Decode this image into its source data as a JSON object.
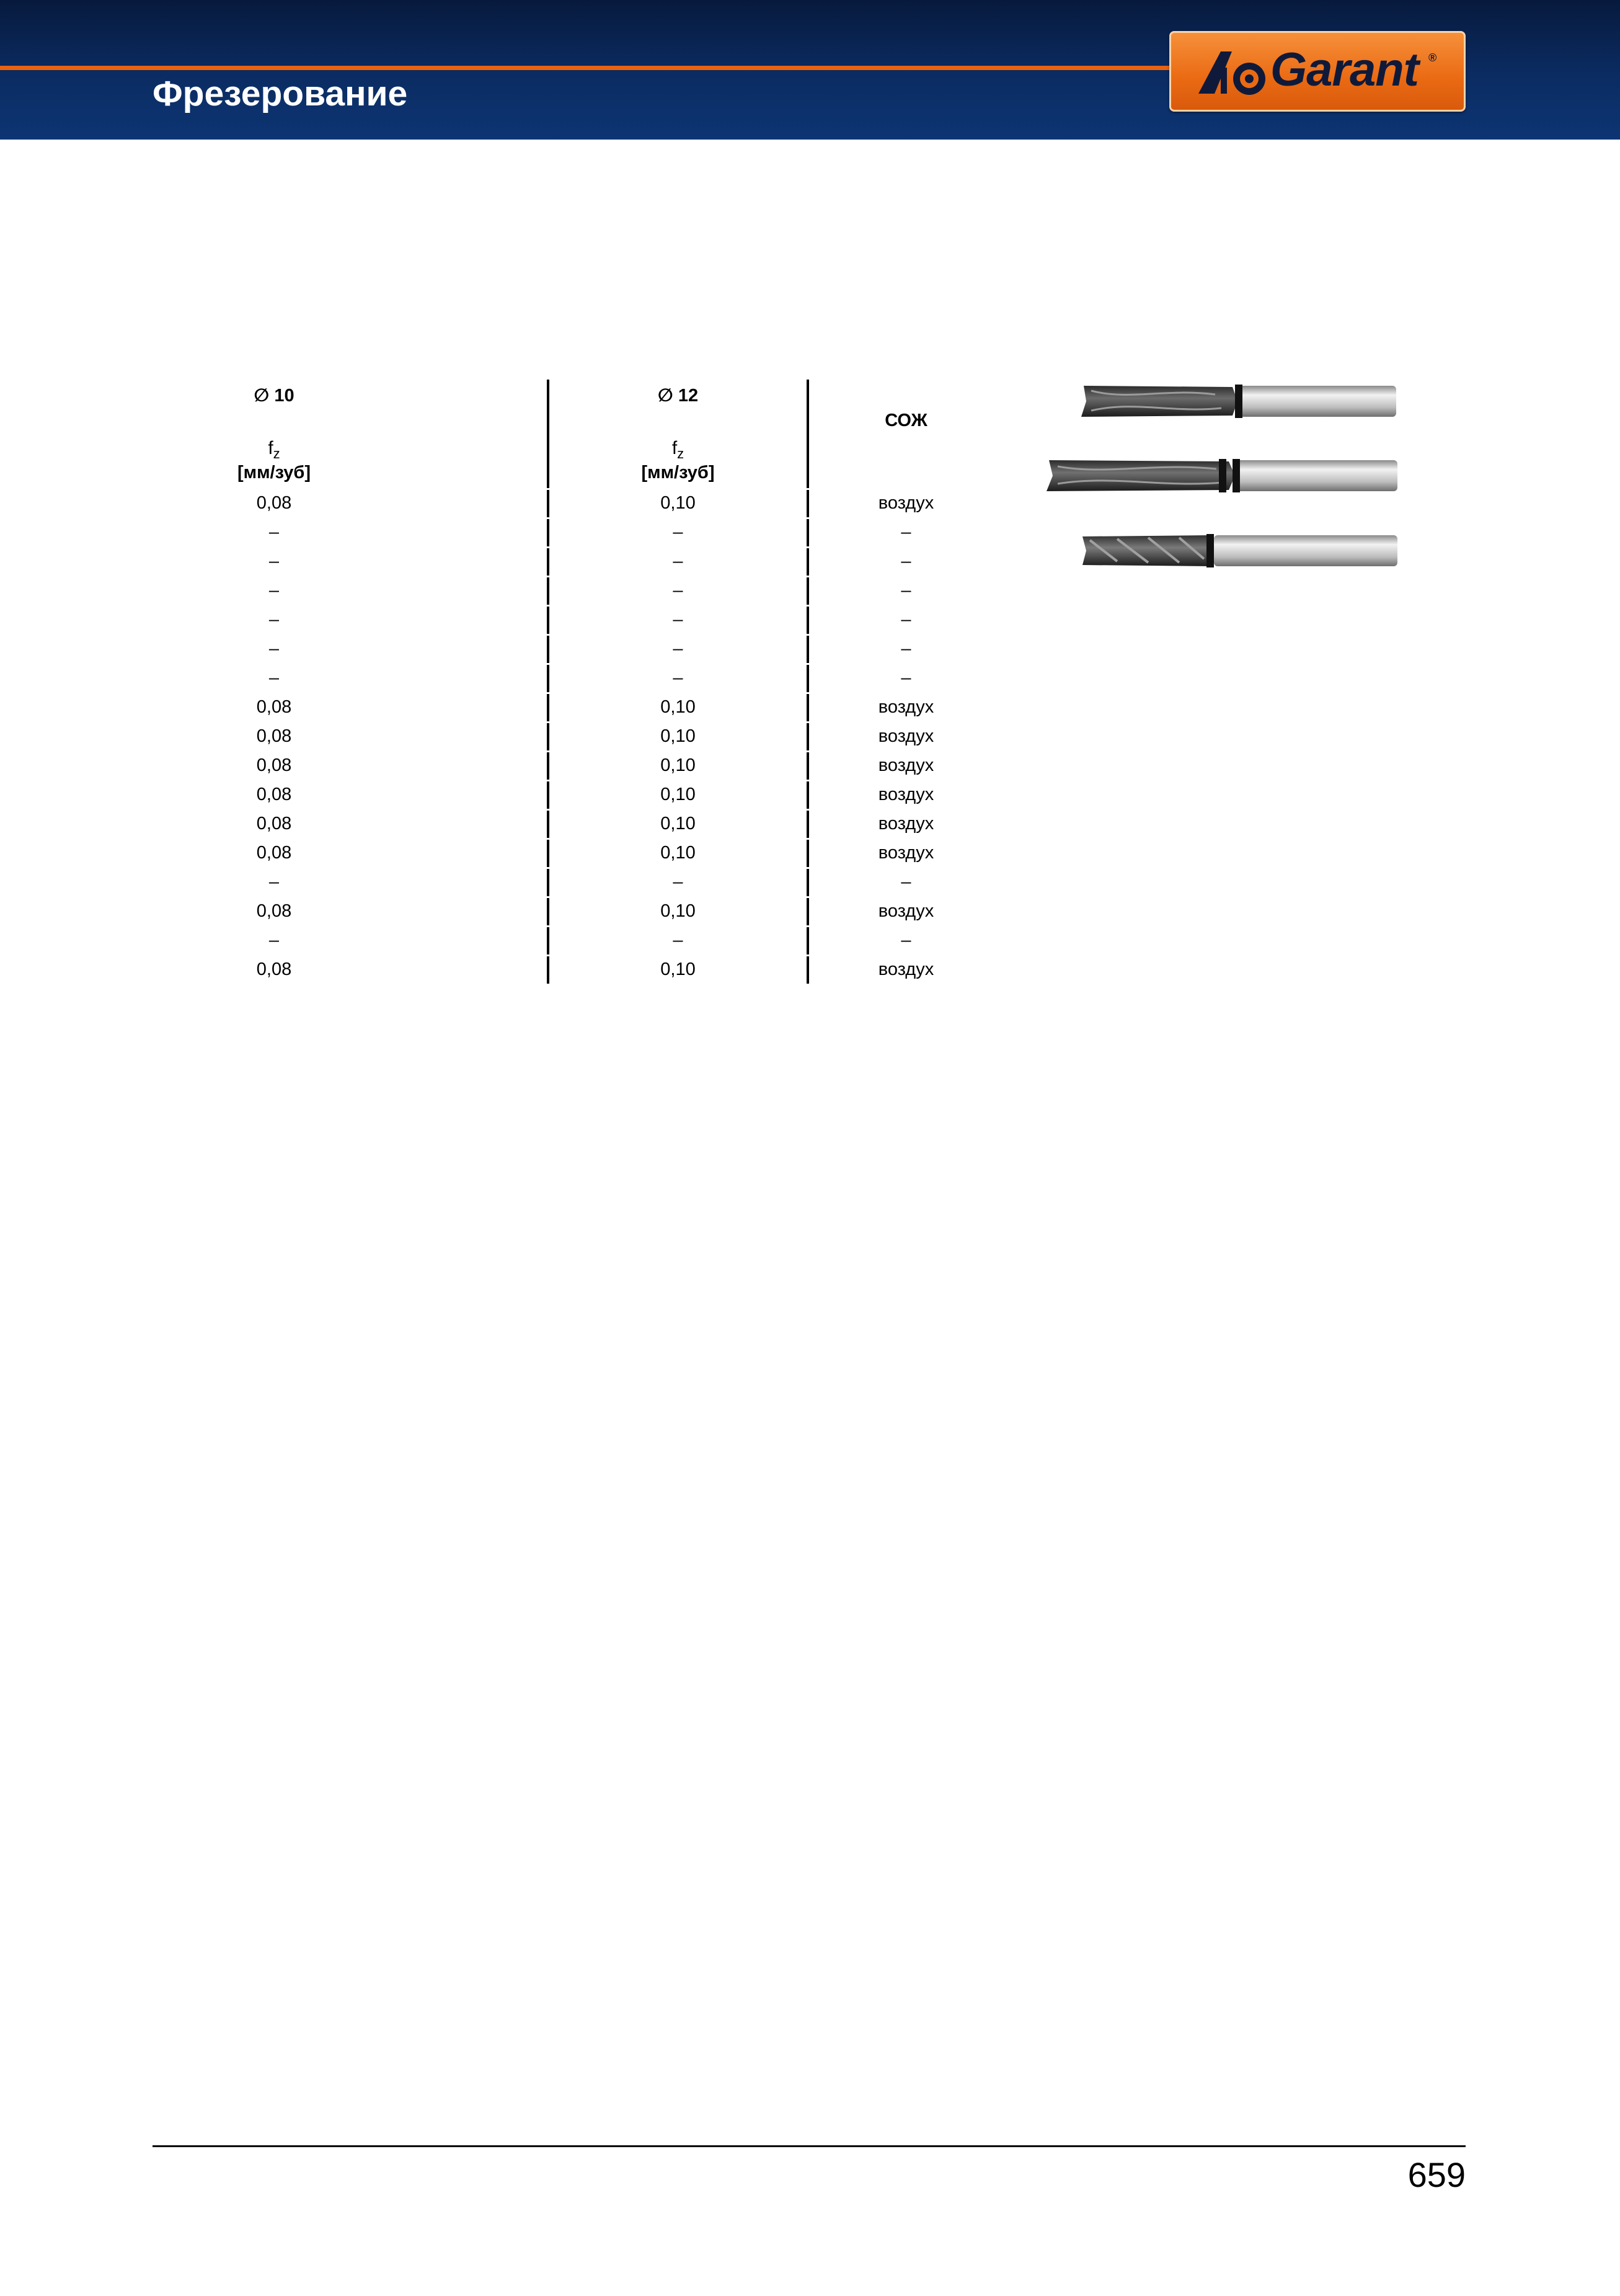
{
  "header": {
    "title": "Фрезерование",
    "logo_text": "Garant",
    "logo_reg": "®"
  },
  "table": {
    "columns": [
      {
        "diameter": "∅ 10",
        "param": "f",
        "param_sub": "z",
        "unit": "[мм/зуб]"
      },
      {
        "diameter": "∅ 12",
        "param": "f",
        "param_sub": "z",
        "unit": "[мм/зуб]"
      },
      {
        "label": "СОЖ"
      }
    ],
    "rows": [
      {
        "style": "yellow",
        "c1": "0,08",
        "c2": "0,10",
        "c3": "воздух"
      },
      {
        "style": "blue",
        "c1": "–",
        "c2": "–",
        "c3": "–"
      },
      {
        "style": "blue",
        "c1": "–",
        "c2": "–",
        "c3": "–"
      },
      {
        "style": "blue",
        "c1": "–",
        "c2": "–",
        "c3": "–"
      },
      {
        "style": "blue",
        "c1": "–",
        "c2": "–",
        "c3": "–"
      },
      {
        "style": "yellow",
        "c1": "–",
        "c2": "–",
        "c3": "–"
      },
      {
        "style": "blue",
        "c1": "–",
        "c2": "–",
        "c3": "–"
      },
      {
        "style": "blue",
        "c1": "0,08",
        "c2": "0,10",
        "c3": "воздух"
      },
      {
        "style": "blue",
        "c1": "0,08",
        "c2": "0,10",
        "c3": "воздух"
      },
      {
        "style": "blue",
        "c1": "0,08",
        "c2": "0,10",
        "c3": "воздух"
      },
      {
        "style": "yellow",
        "c1": "0,08",
        "c2": "0,10",
        "c3": "воздух"
      },
      {
        "style": "blue",
        "c1": "0,08",
        "c2": "0,10",
        "c3": "воздух"
      },
      {
        "style": "blue",
        "c1": "0,08",
        "c2": "0,10",
        "c3": "воздух"
      },
      {
        "style": "blue",
        "c1": "–",
        "c2": "–",
        "c3": "–"
      },
      {
        "style": "blue",
        "c1": "0,08",
        "c2": "0,10",
        "c3": "воздух"
      },
      {
        "style": "blue",
        "c1": "–",
        "c2": "–",
        "c3": "–"
      },
      {
        "style": "blue",
        "c1": "0,08",
        "c2": "0,10",
        "c3": "воздух"
      }
    ]
  },
  "tools": [
    "end-mill-tool-1",
    "end-mill-tool-2",
    "end-mill-tool-3"
  ],
  "footer": {
    "page_number": "659"
  }
}
